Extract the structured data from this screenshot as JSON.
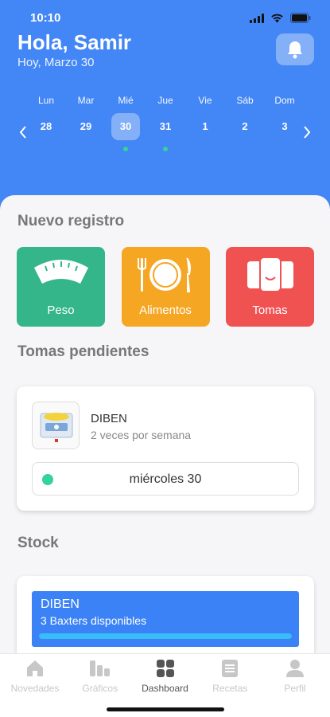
{
  "status_bar": {
    "time": "10:10"
  },
  "header": {
    "greeting": "Hola, Samir",
    "date_sub": "Hoy, Marzo 30",
    "icons": {
      "bell": "bell-icon",
      "prev": "chevron-left-icon",
      "next": "chevron-right-icon"
    }
  },
  "calendar": {
    "days": [
      {
        "dow": "Lun",
        "num": "28",
        "selected": false,
        "dot": false
      },
      {
        "dow": "Mar",
        "num": "29",
        "selected": false,
        "dot": false
      },
      {
        "dow": "Mié",
        "num": "30",
        "selected": true,
        "dot": true
      },
      {
        "dow": "Jue",
        "num": "31",
        "selected": false,
        "dot": true
      },
      {
        "dow": "Vie",
        "num": "1",
        "selected": false,
        "dot": false
      },
      {
        "dow": "Sáb",
        "num": "2",
        "selected": false,
        "dot": false
      },
      {
        "dow": "Dom",
        "num": "3",
        "selected": false,
        "dot": false
      }
    ]
  },
  "nuevo_registro": {
    "title": "Nuevo registro",
    "tiles": [
      {
        "label": "Peso",
        "icon": "scale-icon",
        "color": "#34b58a"
      },
      {
        "label": "Alimentos",
        "icon": "plate-cutlery-icon",
        "color": "#f5a623"
      },
      {
        "label": "Tomas",
        "icon": "phones-icon",
        "color": "#f05252"
      }
    ]
  },
  "tomas_pendientes": {
    "title": "Tomas pendientes",
    "item": {
      "name": "DIBEN",
      "frequency": "2 veces por semana",
      "dose_label": "miércoles 30",
      "status_color": "#34d399"
    }
  },
  "stock": {
    "title": "Stock",
    "item": {
      "name": "DIBEN",
      "subtitle": "3 Baxters disponibles",
      "level": 1.0
    }
  },
  "tabbar": {
    "tabs": [
      {
        "label": "Novedades",
        "icon": "home-icon",
        "active": false
      },
      {
        "label": "Gráficos",
        "icon": "bar-chart-icon",
        "active": false
      },
      {
        "label": "Dashboard",
        "icon": "grid-icon",
        "active": true
      },
      {
        "label": "Recetas",
        "icon": "document-icon",
        "active": false
      },
      {
        "label": "Perfil",
        "icon": "person-icon",
        "active": false
      }
    ]
  },
  "colors": {
    "accent": "#4386f5",
    "green": "#34d399",
    "stock": "#3b82f6"
  }
}
